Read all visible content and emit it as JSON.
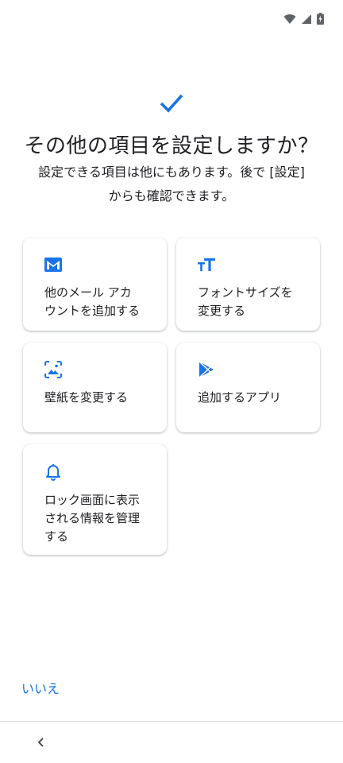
{
  "heading": {
    "title": "その他の項目を設定しますか？",
    "subtitle_line1": "設定できる項目は他にもあります。後で [設定]",
    "subtitle_line2": "からも確認できます。"
  },
  "cards": [
    {
      "icon": "mail-icon",
      "label_line1": "他のメール アカ",
      "label_line2": "ウントを追加する"
    },
    {
      "icon": "font-size-icon",
      "label_line1": "フォントサイズを",
      "label_line2": "変更する"
    },
    {
      "icon": "wallpaper-icon",
      "label_line1": "壁紙を変更する"
    },
    {
      "icon": "play-store-icon",
      "label_line1": "追加するアプリ"
    },
    {
      "icon": "bell-icon",
      "label_line1": "ロック画面に表示",
      "label_line2": "される情報を管理",
      "label_line3": "する"
    }
  ],
  "footer": {
    "no_label": "いいえ"
  },
  "colors": {
    "accent": "#1a73e8",
    "text": "#202124",
    "status_icons": "#5f6368"
  }
}
